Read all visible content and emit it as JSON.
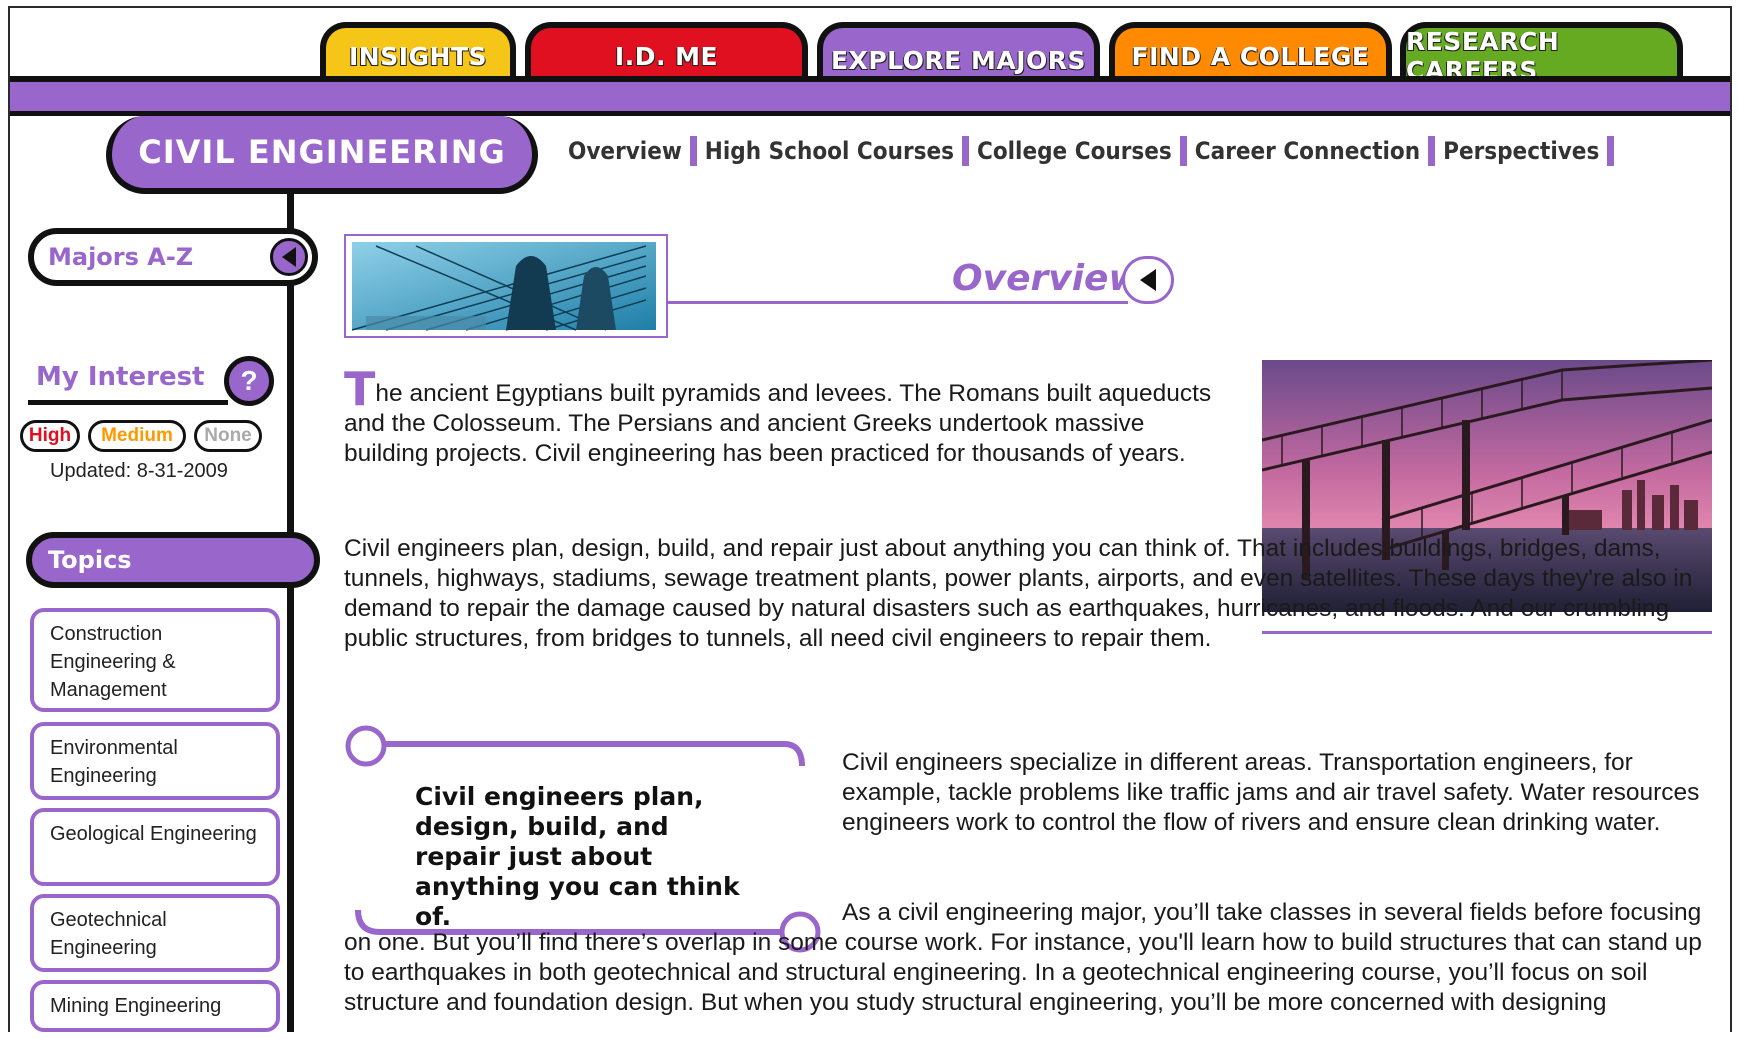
{
  "tabs": {
    "insights": "INSIGHTS",
    "idme": "I.D. ME",
    "explore": "EXPLORE MAJORS",
    "college": "FIND A COLLEGE",
    "careers": "RESEARCH CAREERS"
  },
  "major": {
    "title": "CIVIL ENGINEERING"
  },
  "subnav": [
    "Overview",
    "High School Courses",
    "College Courses",
    "Career Connection",
    "Perspectives"
  ],
  "sidebar": {
    "majors_az": "Majors A-Z",
    "my_interest": "My Interest",
    "help": "?",
    "levels": {
      "high": "High",
      "medium": "Medium",
      "none": "None"
    },
    "updated": "Updated: 8-31-2009",
    "topics_label": "Topics",
    "topics": [
      "Construction Engineering & Management",
      "Environmental Engineering",
      "Geological Engineering",
      "Geotechnical Engineering",
      "Mining Engineering"
    ]
  },
  "main": {
    "section_title": "Overview",
    "dropcap": "T",
    "p1_rest": "he ancient Egyptians built pyramids and levees. The Romans built aqueducts and the Colosseum. The Persians and ancient Greeks undertook massive building projects. Civil engineering has been practiced for thousands of years.",
    "p2": "Civil engineers plan, design, build, and repair just about anything you can think of. That includes buildings, bridges, dams, tunnels, highways, stadiums, sewage treatment plants, power plants, airports, and even satellites. These days they're also in demand to repair the damage caused by natural disasters such as earthquakes, hurricanes, and floods. And our crumbling public structures, from bridges to tunnels, all need civil engineers to repair them.",
    "quote": "Civil engineers plan, design, build, and repair just about anything you can think of.",
    "p3": "Civil engineers specialize in different areas. Transportation engineers, for example, tackle problems like traffic jams and air travel safety. Water resources engineers work to control the flow of rivers and ensure clean drinking water.",
    "p4": "As a civil engineering major, you’ll take classes in several fields before focusing on one. But you’ll find there’s overlap in some course work. For instance, you'll learn how to build structures that can stand up to earthquakes in both geotechnical and structural engineering. In a geotechnical engineering course, you’ll focus on soil structure and foundation design. But when you study structural engineering, you’ll be more concerned with designing"
  },
  "colors": {
    "purple": "#9966cc",
    "yellow": "#f5c518",
    "red": "#e01020",
    "orange": "#ff8a00",
    "green": "#66aa22"
  }
}
